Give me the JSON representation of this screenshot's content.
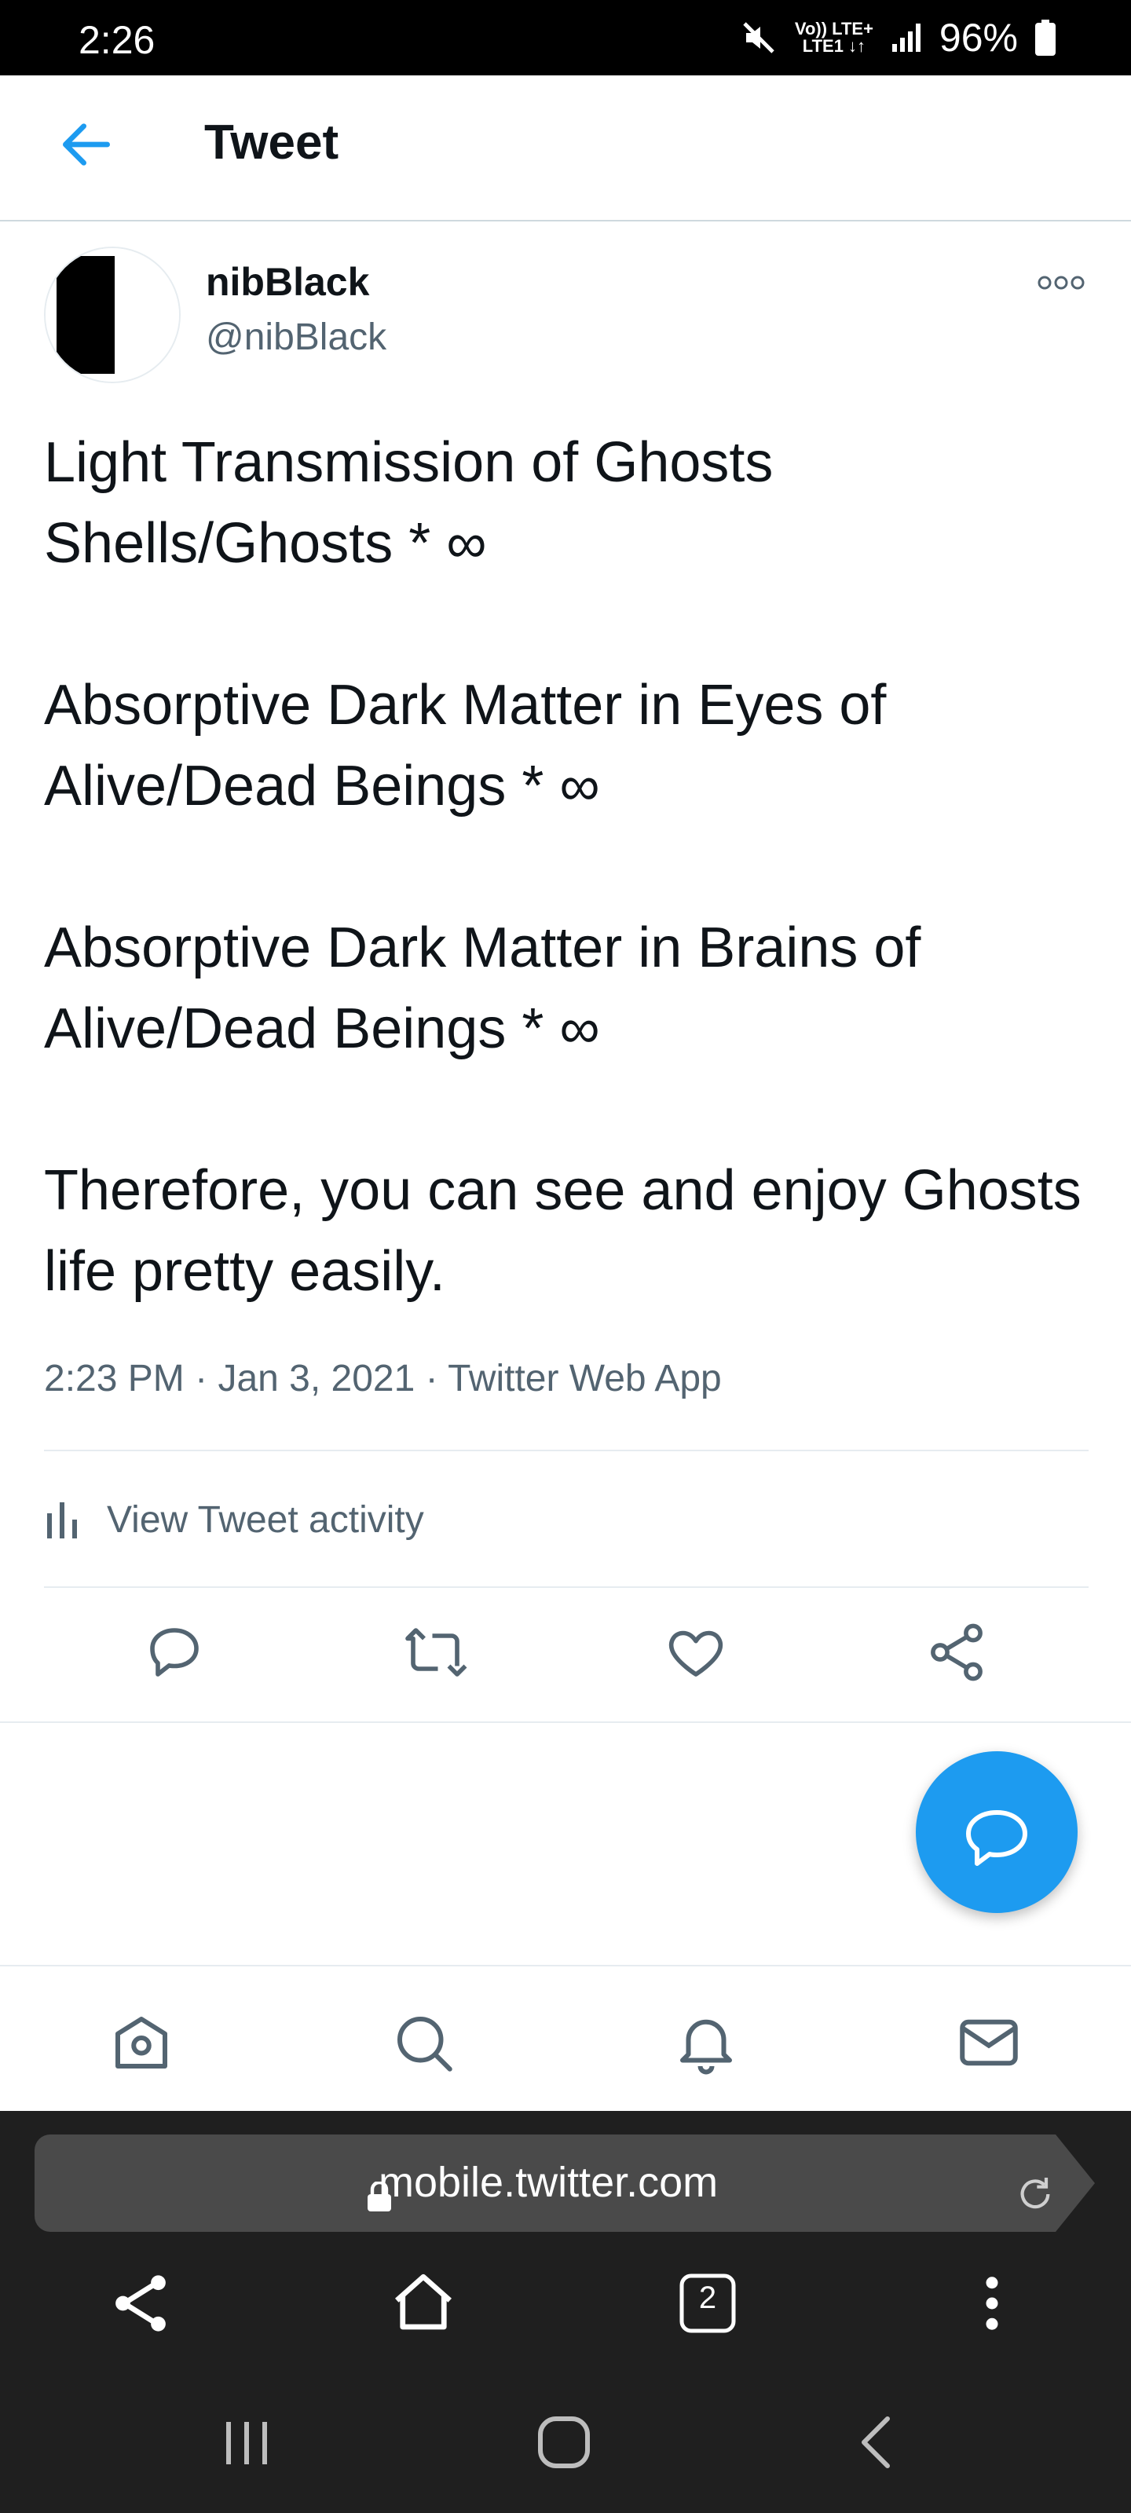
{
  "status_bar": {
    "time": "2:26",
    "network_top": "Vo)) LTE+",
    "network_bottom": "LTE1 ↓↑",
    "battery": "96%",
    "icons": [
      "mute-icon",
      "signal-icon",
      "battery-icon"
    ]
  },
  "header": {
    "back_icon": "arrow-left-icon",
    "title": "Tweet"
  },
  "tweet": {
    "display_name": "nibBlack",
    "handle": "@nibBlack",
    "text": "Light Transmission of Ghosts Shells/Ghosts * ∞\n\nAbsorptive Dark Matter in Eyes of Alive/Dead Beings * ∞\n\nAbsorptive Dark Matter in Brains of Alive/Dead Beings * ∞\n\nTherefore, you can see and enjoy Ghosts life pretty easily.",
    "time": "2:23 PM",
    "date": "Jan 3, 2021",
    "source": "Twitter Web App",
    "activity_label": "View Tweet activity",
    "actions": [
      "reply-icon",
      "retweet-icon",
      "like-icon",
      "share-icon"
    ]
  },
  "fab": {
    "icon": "compose-reply-icon"
  },
  "bottom_nav": [
    "home-icon",
    "search-icon",
    "notifications-icon",
    "messages-icon"
  ],
  "browser": {
    "url": "mobile.twitter.com",
    "tab_count": "2",
    "icons": [
      "lock-icon",
      "reload-icon",
      "share-icon",
      "home-icon",
      "tabs-icon",
      "menu-icon"
    ]
  },
  "system_nav": [
    "recents-icon",
    "home-icon",
    "back-icon"
  ],
  "colors": {
    "accent": "#1d9bf0",
    "text": "#0f1419",
    "secondary_text": "#536471",
    "browser_bg": "#1f1f1f"
  }
}
